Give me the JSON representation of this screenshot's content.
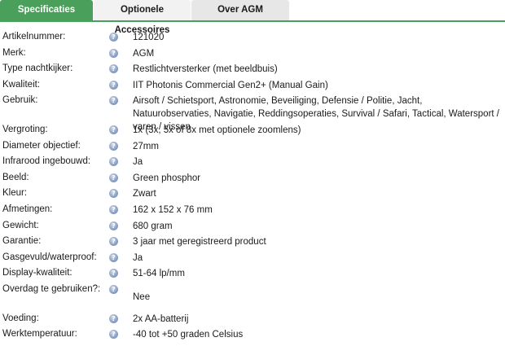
{
  "tabs": [
    {
      "label": "Specificaties",
      "active": true
    },
    {
      "label": "Optionele Accessoires",
      "active": false
    },
    {
      "label": "Over AGM",
      "active": false
    }
  ],
  "colors": {
    "accent": "#4aa05a",
    "info_icon": "#8ea3c4"
  },
  "icon": {
    "info": "?"
  },
  "specs": [
    {
      "label": "Artikelnummer:",
      "value": "121020"
    },
    {
      "label": "Merk:",
      "value": "AGM"
    },
    {
      "label": "Type nachtkijker:",
      "value": "Restlichtversterker (met beeldbuis)"
    },
    {
      "label": "Kwaliteit:",
      "value": "IIT Photonis Commercial Gen2+ (Manual Gain)"
    },
    {
      "label": "Gebruik:",
      "value": "Airsoft / Schietsport, Astronomie, Beveiliging, Defensie / Politie, Jacht, Natuurobservaties, Navigatie, Reddingsoperaties, Survival / Safari, Tactical, Watersport / varen / vissen"
    },
    {
      "label": "Vergroting:",
      "value": "1x (3x, 5x of 8x met optionele zoomlens)"
    },
    {
      "label": "Diameter objectief:",
      "value": "27mm"
    },
    {
      "label": "Infrarood ingebouwd:",
      "value": "Ja"
    },
    {
      "label": "Beeld:",
      "value": "Green phosphor"
    },
    {
      "label": "Kleur:",
      "value": "Zwart"
    },
    {
      "label": "Afmetingen:",
      "value": "162 x 152 x 76 mm"
    },
    {
      "label": "Gewicht:",
      "value": "680 gram"
    },
    {
      "label": "Garantie:",
      "value": "3 jaar met geregistreerd product"
    },
    {
      "label": "Gasgevuld/waterproof:",
      "value": "Ja"
    },
    {
      "label": "Display-kwaliteit:",
      "value": "51-64 lp/mm"
    },
    {
      "label": "Overdag te gebruiken?:",
      "value": "Nee"
    },
    {
      "label": "Voeding:",
      "value": "2x AA-batterij"
    },
    {
      "label": "Werktemperatuur:",
      "value": "-40 tot +50 graden Celsius"
    }
  ]
}
